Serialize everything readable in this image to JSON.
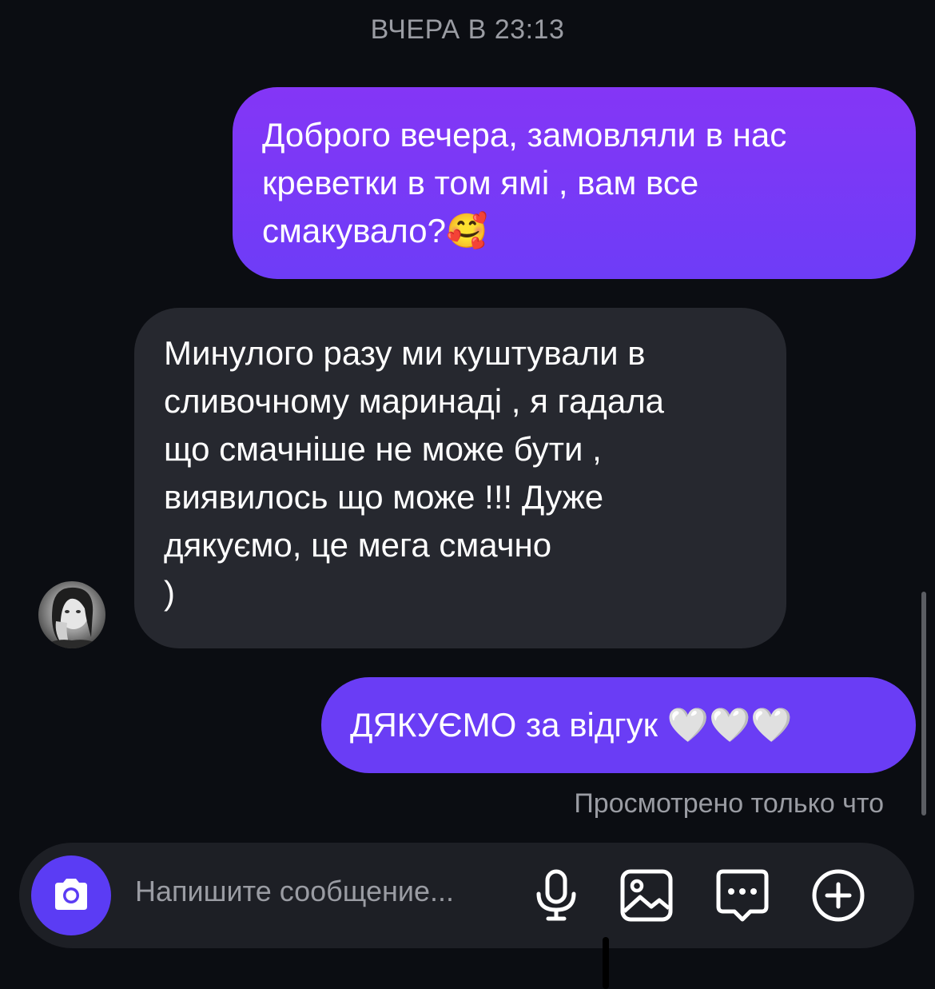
{
  "chat": {
    "timestamp": "ВЧЕРА В 23:13",
    "messages": [
      {
        "direction": "outgoing",
        "lines": [
          "Доброго вечера, замовляли в нас",
          "креветки в том ямі , вам все",
          "смакувало?"
        ],
        "emoji": "🥰"
      },
      {
        "direction": "incoming",
        "lines": [
          "Минулого разу ми куштували в",
          "сливочному маринаді , я гадала",
          "що смачніше не може бути ,",
          "виявилось що може !!!  Дуже",
          "дякуємо, це мега смачно",
          ")"
        ]
      },
      {
        "direction": "outgoing",
        "text": "ДЯКУЄМО за відгук",
        "emoji": "🤍🤍🤍"
      }
    ],
    "seen_status": "Просмотрено только что"
  },
  "composer": {
    "placeholder": "Напишите сообщение...",
    "icons": [
      "camera-icon",
      "microphone-icon",
      "gallery-icon",
      "sticker-icon",
      "plus-icon"
    ]
  },
  "colors": {
    "background": "#0b0d12",
    "outgoing_bubble": "#7b3bf7",
    "incoming_bubble": "#26282f",
    "camera_button": "#5b3cf4",
    "secondary_text": "#9a9ca3"
  }
}
